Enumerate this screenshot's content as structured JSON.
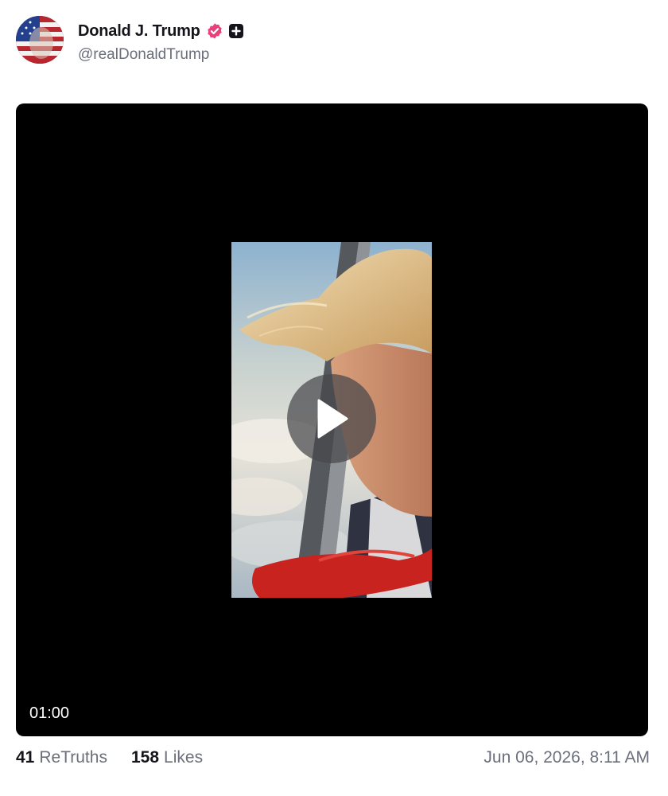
{
  "post": {
    "author": {
      "display_name": "Donald J. Trump",
      "handle": "@realDonaldTrump",
      "verified_color": "#e8407a"
    },
    "media": {
      "type": "video",
      "duration": "01:00"
    },
    "stats": {
      "retruths_count": "41",
      "retruths_label": "ReTruths",
      "likes_count": "158",
      "likes_label": "Likes"
    },
    "timestamp": "Jun 06, 2026, 8:11 AM"
  }
}
